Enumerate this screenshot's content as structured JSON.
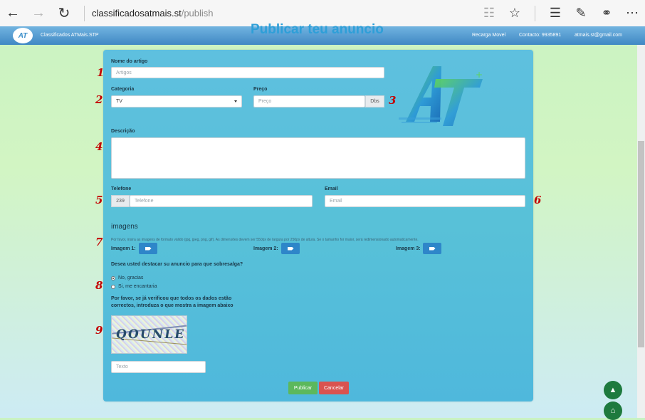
{
  "browser": {
    "url_host": "classificadosatmais.st",
    "url_path": "/publish"
  },
  "header": {
    "logo_text": "AT",
    "brand": "Classificados ATMais.STP",
    "page_heading": "Publicar teu anuncio",
    "recarga": "Recarga Movel",
    "contacto": "Contacto: 9935891",
    "email": "atmais.st@gmail.com"
  },
  "form": {
    "nome_label": "Nome do artigo",
    "nome_placeholder": "Artigos",
    "categoria_label": "Categoria",
    "categoria_value": "TV",
    "preco_label": "Preço",
    "preco_placeholder": "Preço",
    "preco_addon": "Dbs",
    "descricao_label": "Descrição",
    "telefone_label": "Telefone",
    "telefone_prefix": "239",
    "telefone_placeholder": "Telefone",
    "email_label": "Email",
    "email_placeholder": "Email",
    "imagens_title": "imagens",
    "imagens_help": "Por favor, insira as imagens de formato válido (jpg, jpeg, png, gif). As dimensões devem ser 550px de largura por 250px de altura. Se o tamanho for maior, será redimensionado automaticamente.",
    "imagem1_label": "Imagem 1:",
    "imagem2_label": "Imagem 2:",
    "imagem3_label": "Imagem 3:",
    "destacar_question": "Desea usted destacar su anuncio para que sobresalga?",
    "radio_no": "No, gracias",
    "radio_si": "Si, me encantaria",
    "captcha_instruction_1": "Por favor, se já verificou que todos os dados estão",
    "captcha_instruction_2": "correctos, introduza o que mostra a imagem abaixo",
    "captcha_text": "QOUNLE",
    "captcha_placeholder": "Texto",
    "publicar_label": "Publicar",
    "cancelar_label": "Cancelar",
    "logo_text": "AT"
  },
  "annotations": [
    "1",
    "2",
    "3",
    "4",
    "5",
    "6",
    "7",
    "8",
    "9"
  ],
  "colors": {
    "header_blue": "#3f88c4",
    "panel_blue": "#58c1d8",
    "button_green": "#5cb85c",
    "button_red": "#d9534f",
    "annotation_red": "#c40000"
  }
}
